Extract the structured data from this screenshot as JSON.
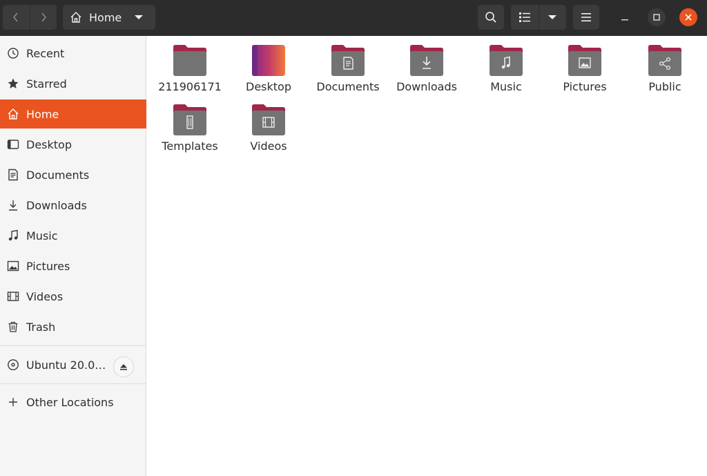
{
  "header": {
    "path_label": "Home",
    "icons": {
      "back": "chevron-left-icon",
      "forward": "chevron-right-icon",
      "path": "home-icon",
      "path_menu": "caret-down-icon",
      "search": "search-icon",
      "view": "list-view-icon",
      "view_menu": "caret-down-icon",
      "menu": "hamburger-menu-icon",
      "minimize": "minimize-icon",
      "maximize": "maximize-icon",
      "close": "close-icon"
    }
  },
  "sidebar": {
    "items": [
      {
        "label": "Recent",
        "icon": "clock-icon"
      },
      {
        "label": "Starred",
        "icon": "star-icon"
      },
      {
        "label": "Home",
        "icon": "home-icon",
        "active": true
      },
      {
        "label": "Desktop",
        "icon": "desktop-icon"
      },
      {
        "label": "Documents",
        "icon": "document-icon"
      },
      {
        "label": "Downloads",
        "icon": "download-icon"
      },
      {
        "label": "Music",
        "icon": "music-icon"
      },
      {
        "label": "Pictures",
        "icon": "picture-icon"
      },
      {
        "label": "Videos",
        "icon": "video-icon"
      },
      {
        "label": "Trash",
        "icon": "trash-icon"
      }
    ],
    "device": {
      "label": "Ubuntu 20.0…",
      "icon": "disc-icon",
      "eject_icon": "eject-icon"
    },
    "other": {
      "label": "Other Locations",
      "icon": "plus-icon"
    }
  },
  "files": [
    {
      "name": "211906171",
      "emblem": "none"
    },
    {
      "name": "Desktop",
      "emblem": "desktop"
    },
    {
      "name": "Documents",
      "emblem": "document"
    },
    {
      "name": "Downloads",
      "emblem": "download"
    },
    {
      "name": "Music",
      "emblem": "music"
    },
    {
      "name": "Pictures",
      "emblem": "picture"
    },
    {
      "name": "Public",
      "emblem": "share"
    },
    {
      "name": "Templates",
      "emblem": "template"
    },
    {
      "name": "Videos",
      "emblem": "video"
    }
  ],
  "colors": {
    "accent": "#e95420",
    "headerbar": "#2c2c2c",
    "folder_body": "#737373",
    "folder_tab": "#a0274a"
  }
}
